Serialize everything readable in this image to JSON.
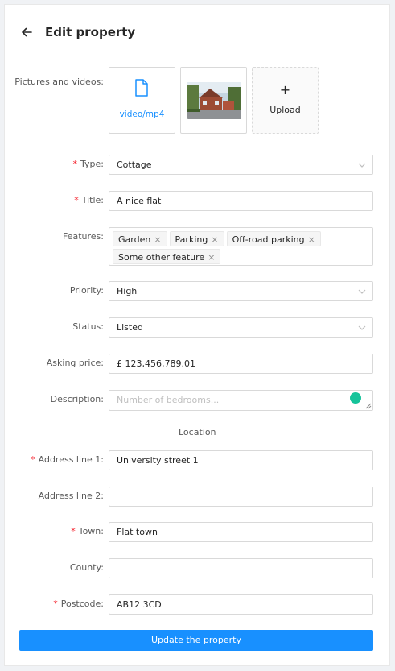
{
  "header": {
    "title": "Edit property"
  },
  "media": {
    "label": "Pictures and videos",
    "video_name": "video/mp4",
    "upload_plus": "+",
    "upload_label": "Upload"
  },
  "form": {
    "type": {
      "label": "Type",
      "value": "Cottage",
      "required": true
    },
    "title": {
      "label": "Title",
      "value": "A nice flat",
      "required": true
    },
    "features": {
      "label": "Features",
      "tags": [
        "Garden",
        "Parking",
        "Off-road parking",
        "Some other feature"
      ]
    },
    "priority": {
      "label": "Priority",
      "value": "High"
    },
    "status": {
      "label": "Status",
      "value": "Listed"
    },
    "asking_price": {
      "label": "Asking price",
      "value": "£ 123,456,789.01"
    },
    "description": {
      "label": "Description",
      "placeholder": "Number of bedrooms..."
    }
  },
  "location": {
    "section_title": "Location",
    "address1": {
      "label": "Address line 1",
      "value": "University street 1",
      "required": true
    },
    "address2": {
      "label": "Address line 2",
      "value": ""
    },
    "town": {
      "label": "Town",
      "value": "Flat town",
      "required": true
    },
    "county": {
      "label": "County",
      "value": ""
    },
    "postcode": {
      "label": "Postcode",
      "value": "AB12 3CD",
      "required": true
    }
  },
  "submit": {
    "label": "Update the property"
  },
  "colors": {
    "primary": "#1890ff",
    "required": "#f5222d",
    "border": "#d9d9d9"
  }
}
